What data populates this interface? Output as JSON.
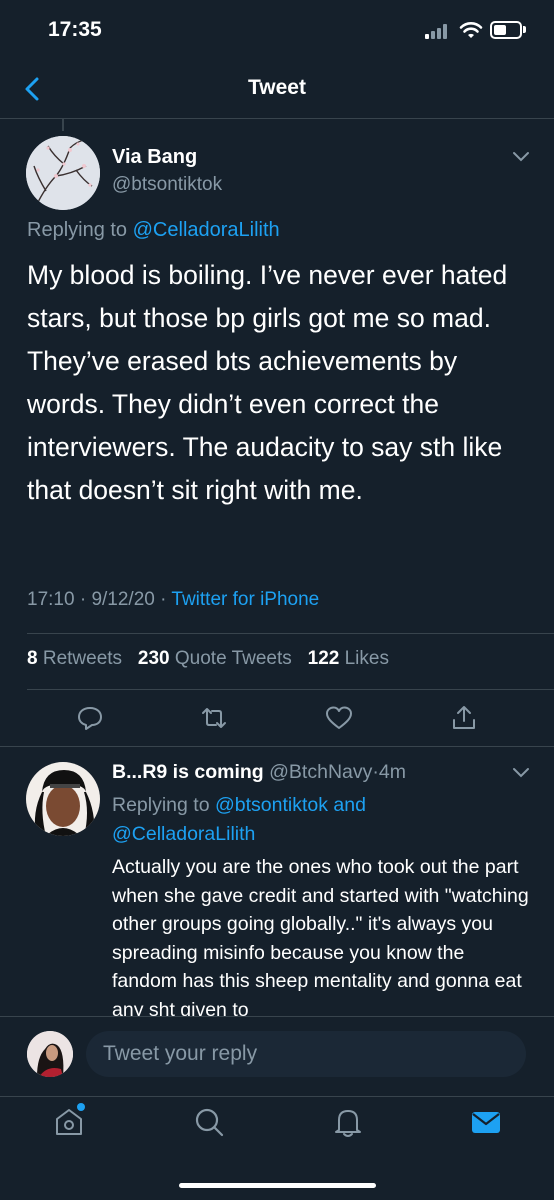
{
  "status_bar": {
    "time": "17:35"
  },
  "nav": {
    "title": "Tweet",
    "back_icon": "chevron-left-icon"
  },
  "tweet": {
    "author_name": "Via Bang",
    "author_handle": "@btsontiktok",
    "replying_prefix": "Replying to ",
    "replying_to": "@CelladoraLilith",
    "text": "My blood is boiling. I’ve never ever hated stars, but those bp girls got me so mad. They’ve erased bts achievements by words. They didn’t even correct the interviewers. The audacity to say sth like that doesn’t sit right with me.",
    "time": "17:10",
    "date": "9/12/20",
    "separator": " · ",
    "source": "Twitter for iPhone",
    "stats": {
      "retweets_count": "8",
      "retweets_label": "Retweets",
      "quotes_count": "230",
      "quotes_label": "Quote Tweets",
      "likes_count": "122",
      "likes_label": "Likes"
    },
    "actions": [
      "reply-icon",
      "retweet-icon",
      "like-icon",
      "share-icon"
    ]
  },
  "reply": {
    "author_name": "B...R9 is coming",
    "author_handle": "@BtchNavy",
    "time_sep": "·",
    "time": "4m",
    "replying_prefix": "Replying to ",
    "replying_to_1": "@btsontiktok",
    "replying_and": " and",
    "replying_to_2": "@CelladoraLilith",
    "text": "Actually you are the ones who took out the part when she gave credit and started with \"watching other groups going globally..\" it's always you spreading misinfo because you know the fandom has this sheep mentality and gonna eat any sht given to"
  },
  "compose": {
    "placeholder": "Tweet your reply"
  },
  "tabbar": {
    "items": [
      "home-icon",
      "search-icon",
      "notifications-icon",
      "messages-icon"
    ],
    "active": "messages-icon"
  },
  "colors": {
    "background": "#15202b",
    "accent": "#1da1f2",
    "secondary_text": "#8899a6",
    "divider": "#38444d"
  }
}
